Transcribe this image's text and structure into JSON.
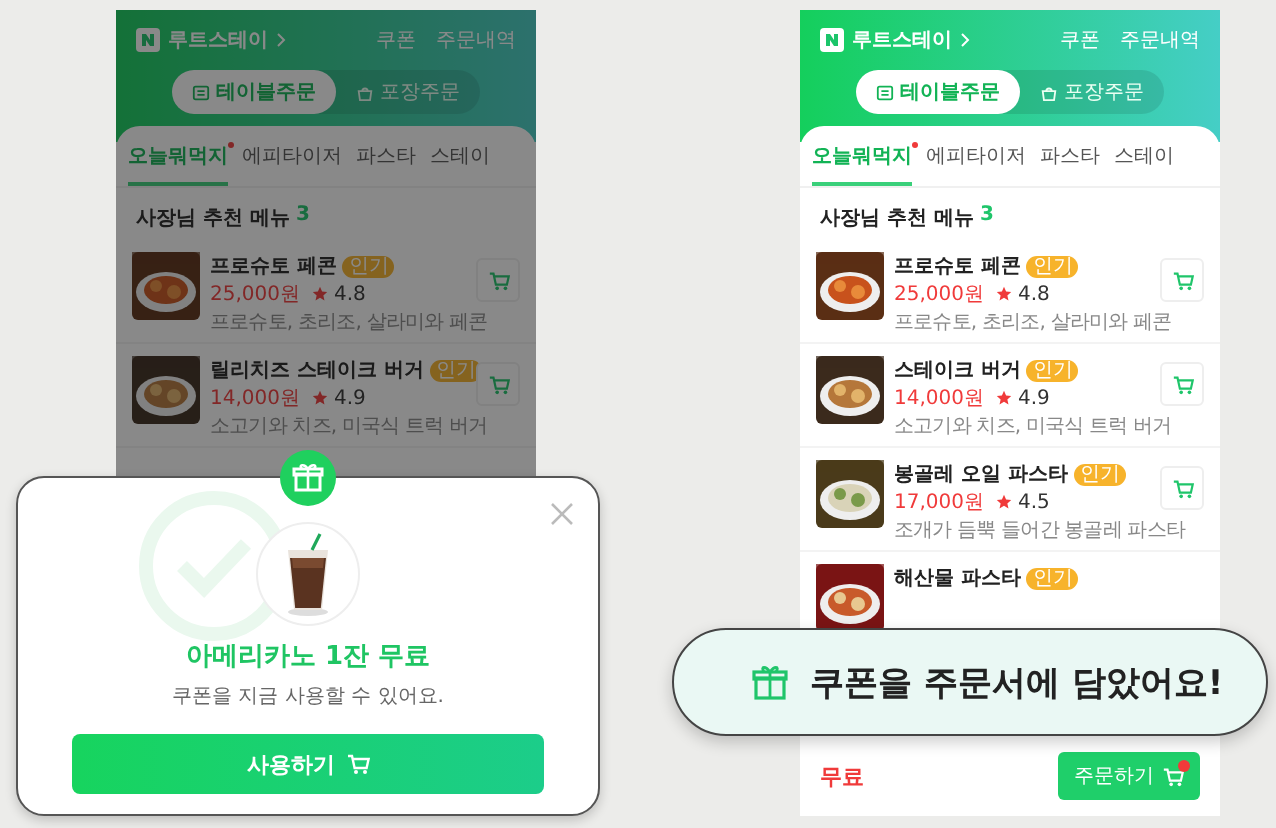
{
  "screens": [
    {
      "dimmed": true,
      "header": {
        "store_name": "루트스테이",
        "links": [
          "쿠폰",
          "주문내역"
        ]
      },
      "order_types": [
        {
          "label": "테이블주문",
          "selected": true
        },
        {
          "label": "포장주문",
          "selected": false
        }
      ],
      "tabs": [
        {
          "label": "오늘뭐먹지",
          "selected": true,
          "new": true
        },
        {
          "label": "에피타이저",
          "selected": false,
          "new": false
        },
        {
          "label": "파스타",
          "selected": false,
          "new": false
        },
        {
          "label": "스테이",
          "selected": false,
          "new": false
        }
      ],
      "section": {
        "title": "사장님 추천 메뉴",
        "count": "3"
      },
      "items": [
        {
          "name": "프로슈토 페콘",
          "badge": "인기",
          "price": "25,000원",
          "rating": "4.8",
          "description": "프로슈토, 초리조, 살라미와 페콘"
        },
        {
          "name": "릴리치즈 스테이크 버거",
          "badge": "인기",
          "price": "14,000원",
          "rating": "4.9",
          "description": "소고기와 치즈, 미국식 트럭 버거"
        }
      ]
    },
    {
      "dimmed": false,
      "header": {
        "store_name": "루트스테이",
        "links": [
          "쿠폰",
          "주문내역"
        ]
      },
      "order_types": [
        {
          "label": "테이블주문",
          "selected": true
        },
        {
          "label": "포장주문",
          "selected": false
        }
      ],
      "tabs": [
        {
          "label": "오늘뭐먹지",
          "selected": true,
          "new": true
        },
        {
          "label": "에피타이저",
          "selected": false,
          "new": false
        },
        {
          "label": "파스타",
          "selected": false,
          "new": false
        },
        {
          "label": "스테이",
          "selected": false,
          "new": false
        }
      ],
      "section": {
        "title": "사장님 추천 메뉴",
        "count": "3"
      },
      "items": [
        {
          "name": "프로슈토 페콘",
          "badge": "인기",
          "price": "25,000원",
          "rating": "4.8",
          "description": "프로슈토, 초리조, 살라미와 페콘"
        },
        {
          "name": "스테이크 버거",
          "badge": "인기",
          "price": "14,000원",
          "rating": "4.9",
          "description": "소고기와 치즈, 미국식 트럭 버거"
        },
        {
          "name": "봉골레 오일 파스타",
          "badge": "인기",
          "price": "17,000원",
          "rating": "4.5",
          "description": "조개가 듬뿍 들어간 봉골레 파스타"
        },
        {
          "name": "해산물 파스타",
          "badge": "인기"
        }
      ],
      "footer": {
        "price": "무료",
        "order_button": "주문하기",
        "cart_has_items": true
      }
    }
  ],
  "coupon_popup": {
    "title": "아메리카노 1잔 무료",
    "message": "쿠폰을 지금 사용할 수 있어요.",
    "button": "사용하기"
  },
  "toast": {
    "text": "쿠폰을 주문서에 담았어요!"
  }
}
